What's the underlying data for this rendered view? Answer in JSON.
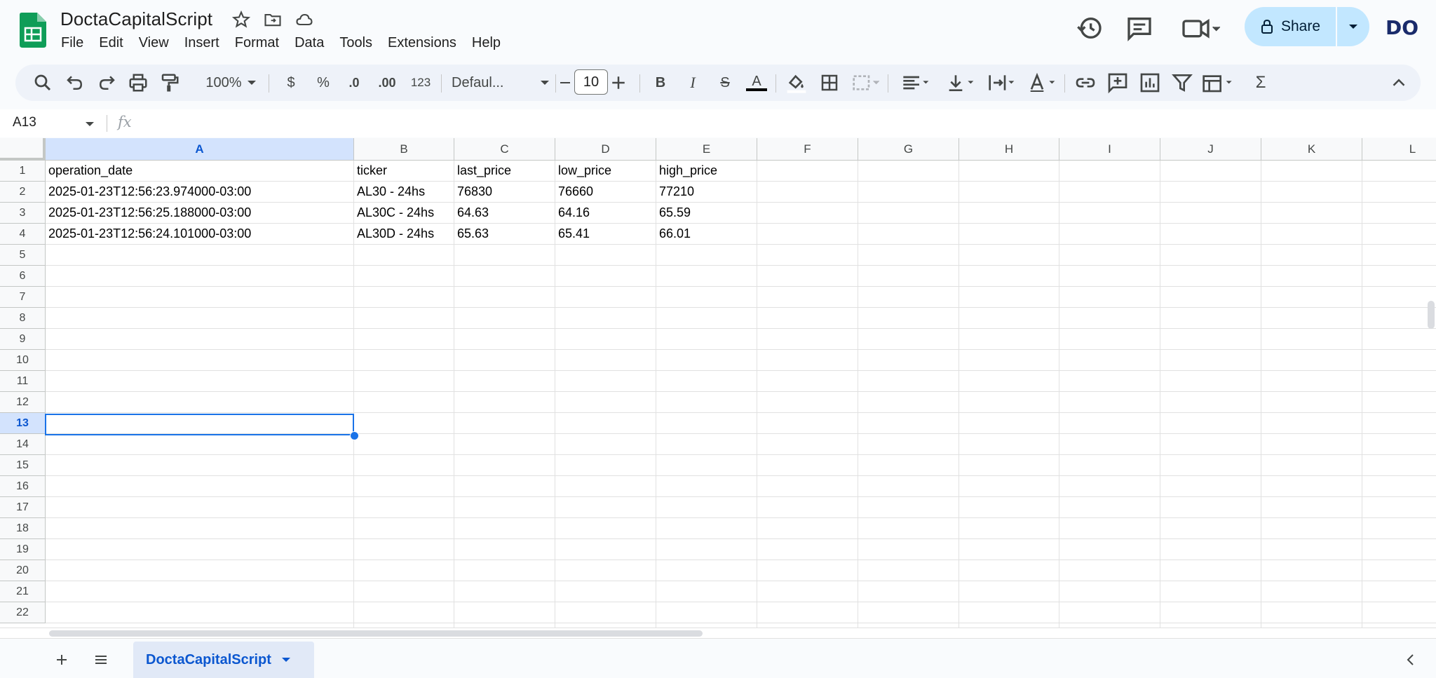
{
  "header": {
    "title": "DoctaCapitalScript",
    "menu": [
      "File",
      "Edit",
      "View",
      "Insert",
      "Format",
      "Data",
      "Tools",
      "Extensions",
      "Help"
    ],
    "share_label": "Share",
    "avatar_text": "DO"
  },
  "toolbar": {
    "zoom": "100%",
    "currency": "$",
    "percent": "%",
    "decrease_decimal": ".0",
    "increase_decimal": ".00",
    "number_format": "123",
    "font": "Defaul...",
    "font_size": "10",
    "bold": "B",
    "italic": "I",
    "text_color": "A",
    "sum": "Σ"
  },
  "formula_bar": {
    "name_box": "A13",
    "fx": "fx",
    "value": ""
  },
  "columns": [
    "A",
    "B",
    "C",
    "D",
    "E",
    "F",
    "G",
    "H",
    "I",
    "J",
    "K",
    "L"
  ],
  "rows": [
    "1",
    "2",
    "3",
    "4",
    "5",
    "6",
    "7",
    "8",
    "9",
    "10",
    "11",
    "12",
    "13",
    "14",
    "15",
    "16",
    "17",
    "18",
    "19",
    "20",
    "21",
    "22"
  ],
  "cells": [
    [
      "operation_date",
      "ticker",
      "last_price",
      "low_price",
      "high_price"
    ],
    [
      "2025-01-23T12:56:23.974000-03:00",
      "AL30 - 24hs",
      "76830",
      "76660",
      "77210"
    ],
    [
      "2025-01-23T12:56:25.188000-03:00",
      "AL30C - 24hs",
      "64.63",
      "64.16",
      "65.59"
    ],
    [
      "2025-01-23T12:56:24.101000-03:00",
      "AL30D - 24hs",
      "65.63",
      "65.41",
      "66.01"
    ]
  ],
  "selected_cell": "A13",
  "sheet_tab": {
    "label": "DoctaCapitalScript"
  },
  "colors": {
    "accent": "#1a73e8",
    "share_bg": "#c2e7ff",
    "logo_green": "#0f9d58",
    "selected_header": "#d3e3fd"
  },
  "icons": [
    "sheets-logo-icon",
    "star-icon",
    "move-folder-icon",
    "cloud-saved-icon",
    "history-icon",
    "comment-icon",
    "meet-icon",
    "lock-icon",
    "search-icon",
    "undo-icon",
    "redo-icon",
    "print-icon",
    "paint-format-icon",
    "fill-color-icon",
    "borders-icon",
    "merge-icon",
    "align-icon",
    "valign-icon",
    "wrap-icon",
    "rotate-icon",
    "link-icon",
    "insert-comment-icon",
    "chart-icon",
    "filter-icon",
    "filter-views-icon",
    "collapse-icon",
    "add-sheet-icon",
    "all-sheets-icon"
  ]
}
